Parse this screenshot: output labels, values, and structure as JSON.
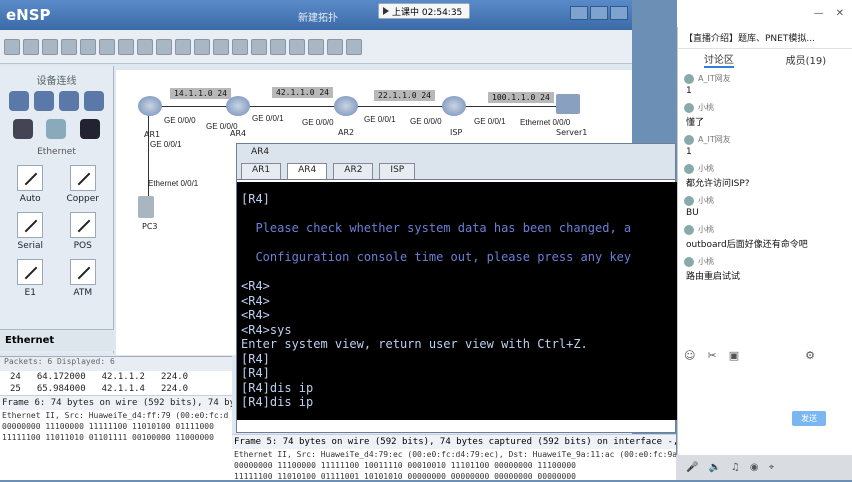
{
  "ensp": {
    "app_title": "eNSP",
    "window_title": "新建拓扑"
  },
  "time_badge": "上课中 02:54:35",
  "left_panel": {
    "title": "设备连线",
    "section_label": "Ethernet",
    "cables": [
      {
        "label": "Auto"
      },
      {
        "label": "Copper"
      },
      {
        "label": "Serial"
      },
      {
        "label": "POS"
      },
      {
        "label": "E1"
      },
      {
        "label": "ATM"
      }
    ],
    "footer_label": "Ethernet"
  },
  "topology": {
    "nets": [
      "14.1.1.0 24",
      "42.1.1.0 24",
      "22.1.1.0 24",
      "100.1.1.0 24"
    ],
    "nodes": [
      "AR1",
      "AR4",
      "AR2",
      "ISP",
      "Server1",
      "PC3"
    ],
    "ports": [
      "GE 0/0/0",
      "GE 0/0/0",
      "GE 0/0/1",
      "GE 0/0/0",
      "GE 0/0/1",
      "GE 0/0/0",
      "GE 0/0/1",
      "Ethernet 0/0/0",
      "GE 0/0/1",
      "Ethernet 0/0/1"
    ]
  },
  "packets": {
    "filter_text": "Packets: 6 Displayed: 6",
    "rows": [
      {
        "no": "24",
        "time": "64.172000",
        "src": "42.1.1.2",
        "dst": "224.0"
      },
      {
        "no": "25",
        "time": "65.984000",
        "src": "42.1.1.4",
        "dst": "224.0"
      }
    ],
    "detail": "Frame 6: 74 bytes on wire (592 bits), 74 bytes",
    "hex": [
      "Ethernet II, Src: HuaweiTe_d4:ff:79 (00:e0:fc:d",
      "00000000 11100000 11111100 11010100 01111000",
      "11111100 11011010 01101111 00100000 11000000"
    ]
  },
  "cli": {
    "title": "AR4",
    "tabs": [
      "AR1",
      "AR4",
      "AR2",
      "ISP"
    ],
    "active_tab": "AR4",
    "lines": [
      "[R4]",
      "",
      "  Please check whether system data has been changed, a",
      "",
      "  Configuration console time out, please press any key",
      "",
      "<R4>",
      "<R4>",
      "<R4>",
      "<R4>sys",
      "Enter system view, return user view with Ctrl+Z.",
      "[R4]",
      "[R4]",
      "[R4]dis ip",
      "[R4]dis ip"
    ]
  },
  "bottom_detail": {
    "frame": "Frame 5: 74 bytes on wire (592 bits), 74 bytes captured (592 bits) on interface -, id 0",
    "eth": "Ethernet II, Src: HuaweiTe_d4:79:ec (00:e0:fc:d4:79:ec), Dst: HuaweiTe_9a:11:ac (00:e0:fc:9a",
    "hex1": "00000000 11100000 11111100 10011110 00010010 11101100 00000000 11100000",
    "hex2": "11111100 11010100 01111001 10101010 00000000 00000000 00000000 00000000"
  },
  "chat": {
    "header": "【直播介绍】题库、PNET模拟...",
    "tabs": [
      "讨论区",
      "成员(19)"
    ],
    "messages": [
      {
        "user": "A_IT网友",
        "text": "1"
      },
      {
        "user": "小桃",
        "text": "懂了"
      },
      {
        "user": "A_IT网友",
        "text": "1"
      },
      {
        "user": "小桃",
        "text": "都允许访问ISP?"
      },
      {
        "user": "小桃",
        "text": "BU"
      },
      {
        "user": "小桃",
        "text": "outboard后面好像还有命令吧"
      },
      {
        "user": "小桃",
        "text": "路由重启试试"
      }
    ],
    "send_label": "发送"
  }
}
